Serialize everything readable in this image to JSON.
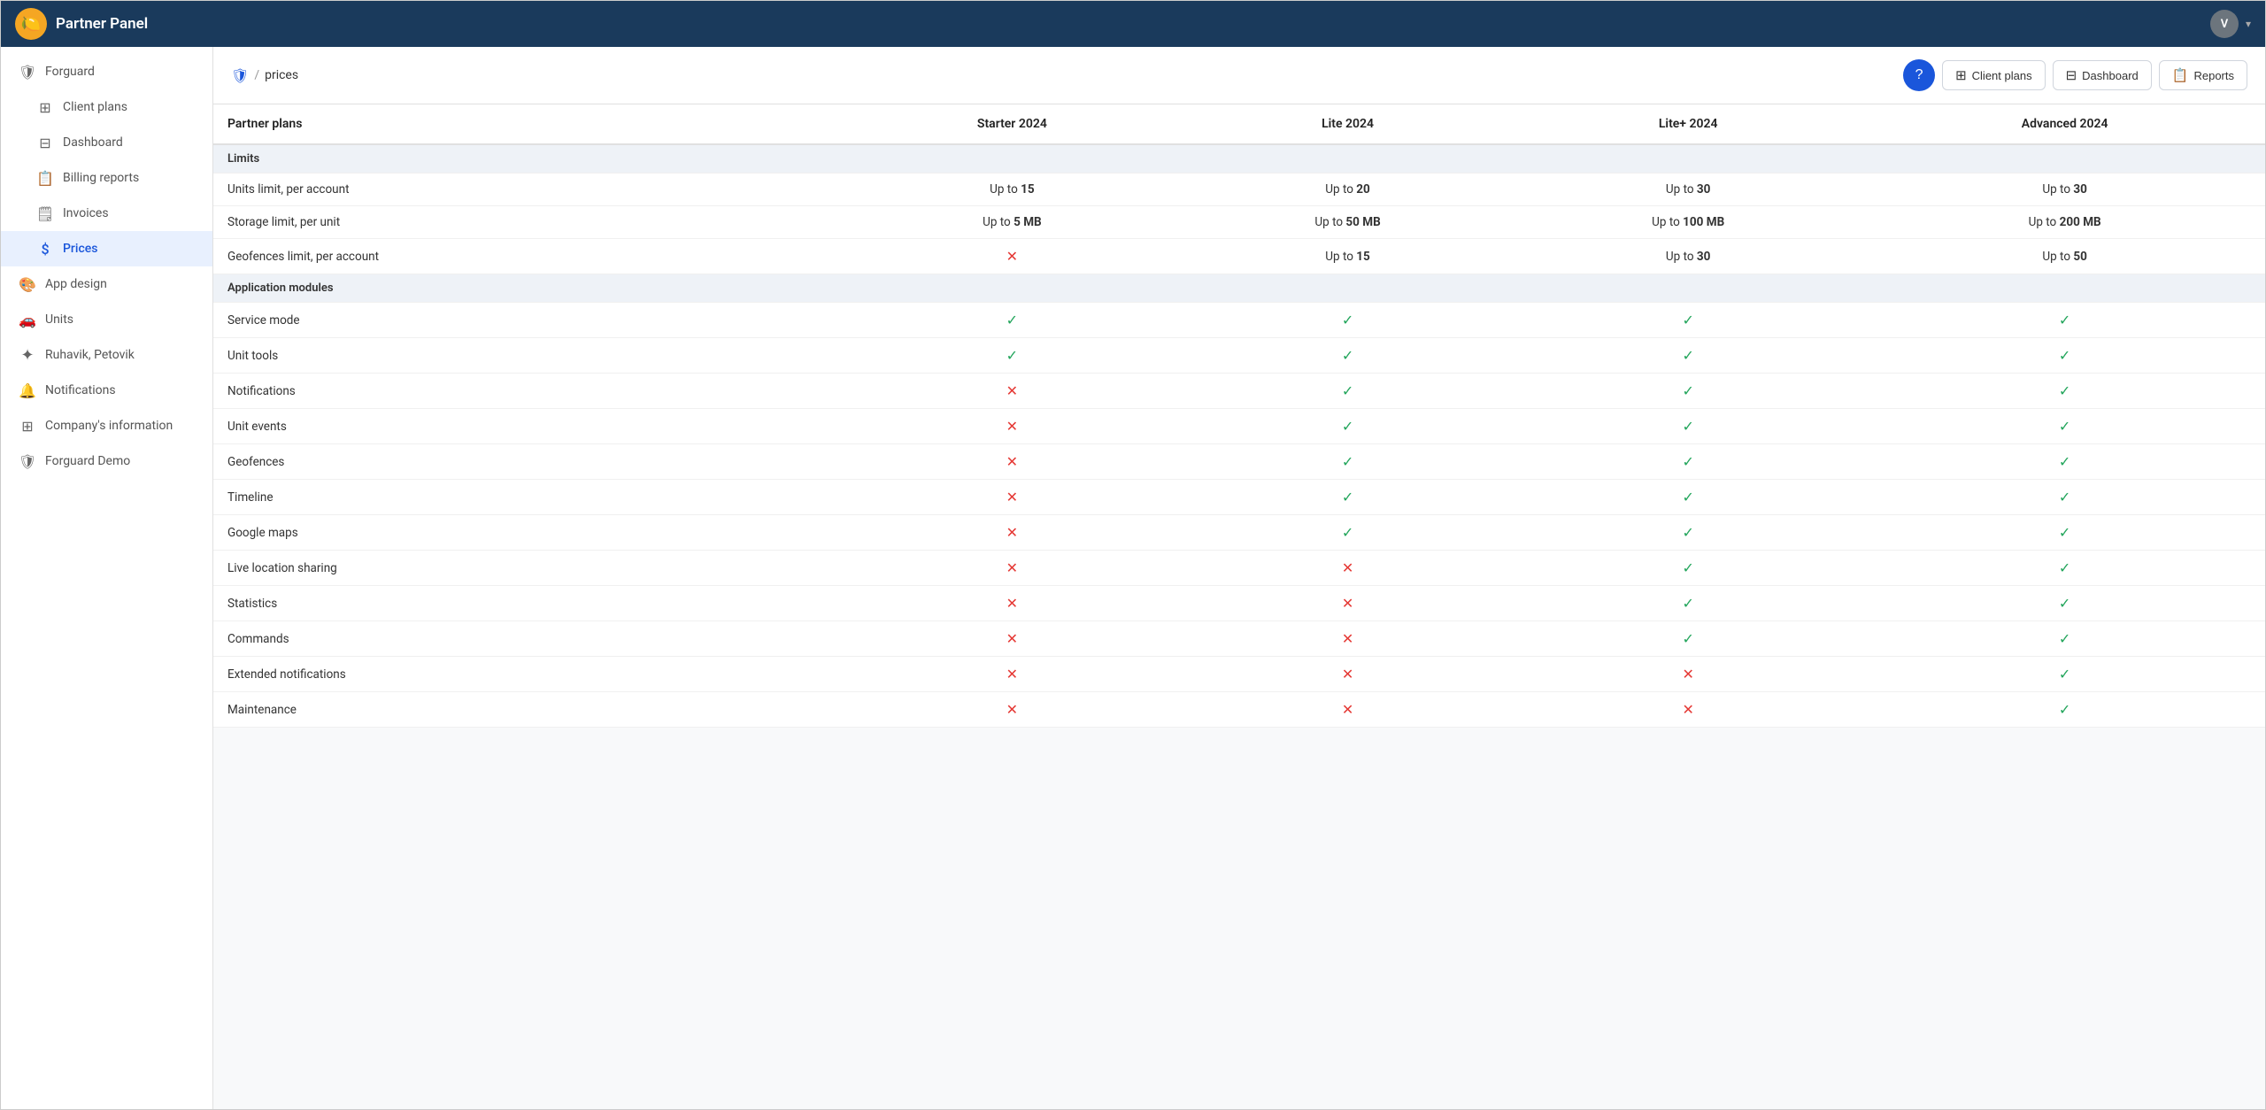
{
  "topbar": {
    "title": "Partner Panel",
    "logo_emoji": "🍋",
    "avatar_initial": "V"
  },
  "sidebar": {
    "items": [
      {
        "id": "forguard",
        "label": "Forguard",
        "icon": "🛡",
        "active": false
      },
      {
        "id": "client-plans",
        "label": "Client plans",
        "icon": "⊞",
        "active": false,
        "indent": true
      },
      {
        "id": "dashboard",
        "label": "Dashboard",
        "icon": "⊟",
        "active": false,
        "indent": true
      },
      {
        "id": "billing-reports",
        "label": "Billing reports",
        "icon": "📋",
        "active": false,
        "indent": true
      },
      {
        "id": "invoices",
        "label": "Invoices",
        "icon": "🗒",
        "active": false,
        "indent": true
      },
      {
        "id": "prices",
        "label": "Prices",
        "icon": "$",
        "active": true,
        "indent": true
      },
      {
        "id": "app-design",
        "label": "App design",
        "icon": "🎨",
        "active": false
      },
      {
        "id": "units",
        "label": "Units",
        "icon": "🚗",
        "active": false
      },
      {
        "id": "ruhavik",
        "label": "Ruhavik, Petovik",
        "icon": "✦",
        "active": false
      },
      {
        "id": "notifications",
        "label": "Notifications",
        "icon": "🔔",
        "active": false
      },
      {
        "id": "company-info",
        "label": "Company's information",
        "icon": "⊞",
        "active": false
      },
      {
        "id": "forguard-demo",
        "label": "Forguard Demo",
        "icon": "🛡",
        "active": false
      }
    ]
  },
  "breadcrumb": {
    "icon": "🛡",
    "sep": "/",
    "current": "prices"
  },
  "header_buttons": {
    "client_plans": "Client plans",
    "dashboard": "Dashboard",
    "reports": "Reports"
  },
  "table": {
    "columns": [
      "Partner plans",
      "Starter 2024",
      "Lite 2024",
      "Lite+ 2024",
      "Advanced 2024"
    ],
    "sections": [
      {
        "section_label": "Limits",
        "rows": [
          {
            "feature": "Units limit, per account",
            "starter": {
              "type": "text",
              "value": "Up to ",
              "bold": "15"
            },
            "lite": {
              "type": "text",
              "value": "Up to ",
              "bold": "20"
            },
            "lite_plus": {
              "type": "text",
              "value": "Up to ",
              "bold": "30"
            },
            "advanced": {
              "type": "text",
              "value": "Up to ",
              "bold": "30"
            }
          },
          {
            "feature": "Storage limit, per unit",
            "starter": {
              "type": "text",
              "value": "Up to ",
              "bold": "5 MB"
            },
            "lite": {
              "type": "text",
              "value": "Up to ",
              "bold": "50 MB"
            },
            "lite_plus": {
              "type": "text",
              "value": "Up to ",
              "bold": "100 MB"
            },
            "advanced": {
              "type": "text",
              "value": "Up to ",
              "bold": "200 MB"
            }
          },
          {
            "feature": "Geofences limit, per account",
            "starter": {
              "type": "cross"
            },
            "lite": {
              "type": "text",
              "value": "Up to ",
              "bold": "15"
            },
            "lite_plus": {
              "type": "text",
              "value": "Up to ",
              "bold": "30"
            },
            "advanced": {
              "type": "text",
              "value": "Up to ",
              "bold": "50"
            }
          }
        ]
      },
      {
        "section_label": "Application modules",
        "rows": [
          {
            "feature": "Service mode",
            "starter": {
              "type": "check"
            },
            "lite": {
              "type": "check"
            },
            "lite_plus": {
              "type": "check"
            },
            "advanced": {
              "type": "check"
            }
          },
          {
            "feature": "Unit tools",
            "starter": {
              "type": "check"
            },
            "lite": {
              "type": "check"
            },
            "lite_plus": {
              "type": "check"
            },
            "advanced": {
              "type": "check"
            }
          },
          {
            "feature": "Notifications",
            "starter": {
              "type": "cross"
            },
            "lite": {
              "type": "check"
            },
            "lite_plus": {
              "type": "check"
            },
            "advanced": {
              "type": "check"
            }
          },
          {
            "feature": "Unit events",
            "starter": {
              "type": "cross"
            },
            "lite": {
              "type": "check"
            },
            "lite_plus": {
              "type": "check"
            },
            "advanced": {
              "type": "check"
            }
          },
          {
            "feature": "Geofences",
            "starter": {
              "type": "cross"
            },
            "lite": {
              "type": "check"
            },
            "lite_plus": {
              "type": "check"
            },
            "advanced": {
              "type": "check"
            }
          },
          {
            "feature": "Timeline",
            "starter": {
              "type": "cross"
            },
            "lite": {
              "type": "check"
            },
            "lite_plus": {
              "type": "check"
            },
            "advanced": {
              "type": "check"
            }
          },
          {
            "feature": "Google maps",
            "starter": {
              "type": "cross"
            },
            "lite": {
              "type": "check"
            },
            "lite_plus": {
              "type": "check"
            },
            "advanced": {
              "type": "check"
            }
          },
          {
            "feature": "Live location sharing",
            "starter": {
              "type": "cross"
            },
            "lite": {
              "type": "cross"
            },
            "lite_plus": {
              "type": "check"
            },
            "advanced": {
              "type": "check"
            }
          },
          {
            "feature": "Statistics",
            "starter": {
              "type": "cross"
            },
            "lite": {
              "type": "cross"
            },
            "lite_plus": {
              "type": "check"
            },
            "advanced": {
              "type": "check"
            }
          },
          {
            "feature": "Commands",
            "starter": {
              "type": "cross"
            },
            "lite": {
              "type": "cross"
            },
            "lite_plus": {
              "type": "check"
            },
            "advanced": {
              "type": "check"
            }
          },
          {
            "feature": "Extended notifications",
            "starter": {
              "type": "cross"
            },
            "lite": {
              "type": "cross"
            },
            "lite_plus": {
              "type": "cross"
            },
            "advanced": {
              "type": "check"
            }
          },
          {
            "feature": "Maintenance",
            "starter": {
              "type": "cross"
            },
            "lite": {
              "type": "cross"
            },
            "lite_plus": {
              "type": "cross"
            },
            "advanced": {
              "type": "check"
            }
          }
        ]
      }
    ]
  }
}
